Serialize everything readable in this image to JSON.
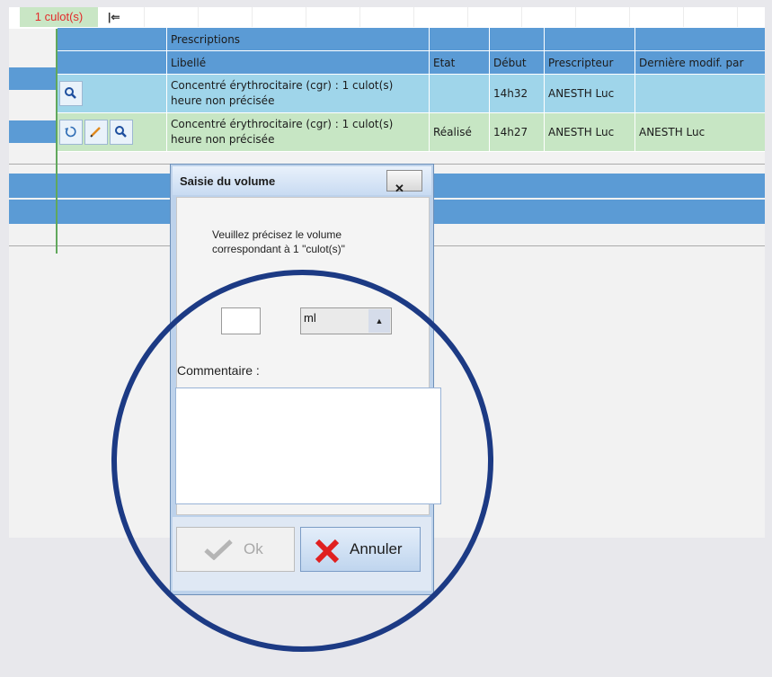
{
  "top": {
    "badge": "1 culot(s)"
  },
  "grid": {
    "group_header": "Prescriptions",
    "columns": [
      "Libellé",
      "Etat",
      "Début",
      "Prescripteur",
      "Dernière modif. par"
    ],
    "rows": [
      {
        "libelle": "Concentré érythrocitaire (cgr) : 1 culot(s) heure non précisée",
        "etat": "",
        "debut": "14h32",
        "prescripteur": "ANESTH Luc",
        "modif": ""
      },
      {
        "libelle": "Concentré érythrocitaire (cgr) : 1 culot(s) heure non précisée",
        "etat": "Réalisé",
        "debut": "14h27",
        "prescripteur": "ANESTH Luc",
        "modif": "ANESTH Luc"
      }
    ],
    "row_icons": [
      [
        "search-icon"
      ],
      [
        "undo-icon",
        "edit-icon",
        "search-icon"
      ]
    ]
  },
  "dialog": {
    "title": "Saisie du volume",
    "close_label": "✕",
    "message": "Veuillez précisez le volume correspondant à 1 \"culot(s)\"",
    "volume_value": "",
    "unit_value": "ml",
    "comment_label": "Commentaire :",
    "comment_value": "",
    "ok_label": "Ok",
    "cancel_label": "Annuler"
  },
  "colors": {
    "band_blue": "#5b9bd5",
    "row_blue": "#9fd5ea",
    "row_green": "#c7e6c4",
    "badge_text": "#e32b2b",
    "highlight_circle": "#1c3a84",
    "cancel_red": "#e02020"
  }
}
